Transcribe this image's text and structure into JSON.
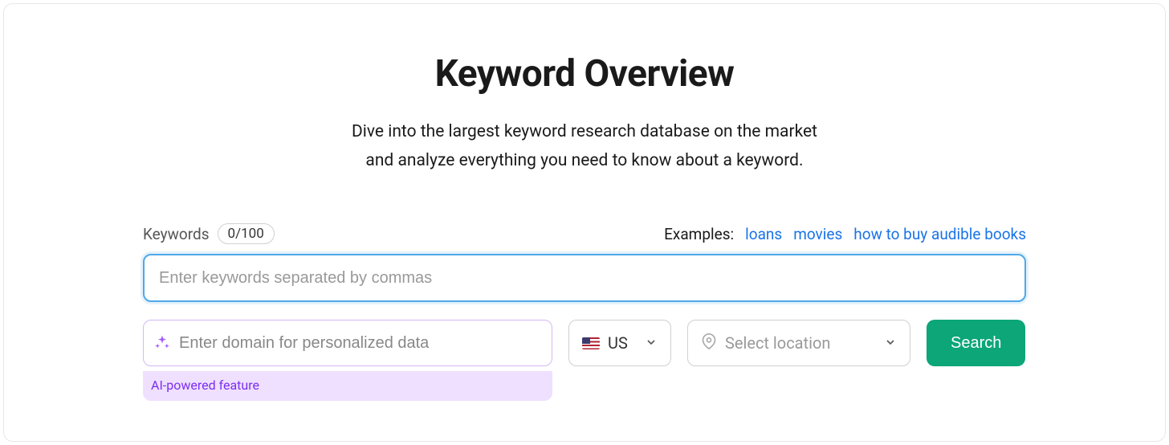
{
  "header": {
    "title": "Keyword Overview",
    "subtitle_line1": "Dive into the largest keyword research database on the market",
    "subtitle_line2": "and analyze everything you need to know about a keyword."
  },
  "form": {
    "keywords_label": "Keywords",
    "keywords_count": "0/100",
    "examples_label": "Examples:",
    "examples": [
      "loans",
      "movies",
      "how to buy audible books"
    ],
    "keyword_placeholder": "Enter keywords separated by commas",
    "domain_placeholder": "Enter domain for personalized data",
    "ai_badge": "AI-powered feature",
    "country": "US",
    "location_placeholder": "Select location",
    "search_label": "Search"
  }
}
